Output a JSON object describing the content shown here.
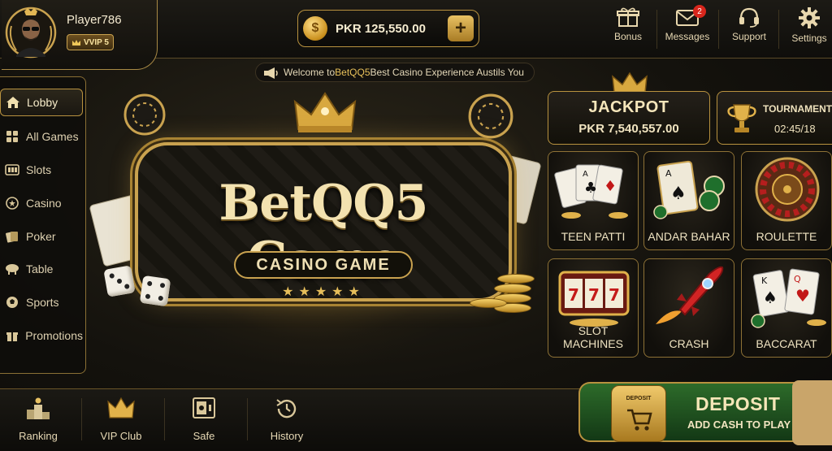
{
  "profile": {
    "name": "Player786",
    "vip": "VVIP 5"
  },
  "balance": {
    "amount": "PKR 125,550.00",
    "coin_symbol": "$",
    "add_label": "+"
  },
  "top_nav": [
    {
      "label": "Bonus",
      "icon": "gift-icon"
    },
    {
      "label": "Messages",
      "icon": "envelope-icon",
      "badge": "2"
    },
    {
      "label": "Support",
      "icon": "headset-icon"
    },
    {
      "label": "Settings",
      "icon": "gear-icon"
    }
  ],
  "ticker": {
    "prefix": "Welcome to ",
    "brand": "BetQQ5",
    "suffix": " Best Casino Experience Austils You"
  },
  "sidebar": {
    "items": [
      {
        "label": "Lobby",
        "icon": "home-icon"
      },
      {
        "label": "All Games",
        "icon": "grid-icon"
      },
      {
        "label": "Slots",
        "icon": "slot-icon"
      },
      {
        "label": "Casino",
        "icon": "chip-icon"
      },
      {
        "label": "Poker",
        "icon": "cards-icon"
      },
      {
        "label": "Table",
        "icon": "table-icon"
      },
      {
        "label": "Sports",
        "icon": "ball-icon"
      },
      {
        "label": "Promotions",
        "icon": "gift-icon"
      }
    ]
  },
  "banner": {
    "title": "BetQQ5 Game",
    "subtitle": "CASINO GAME",
    "stars": "★★★★★"
  },
  "jackpot": {
    "title": "JACKPOT",
    "amount": "PKR 7,540,557.00"
  },
  "tournament": {
    "title": "TOURNAMENT",
    "time": "02:45/18"
  },
  "games": [
    {
      "label": "TEEN PATTI"
    },
    {
      "label": "ANDAR BAHAR"
    },
    {
      "label": "ROULETTE"
    },
    {
      "label": "SLOT MACHINES"
    },
    {
      "label": "CRASH"
    },
    {
      "label": "BACCARAT"
    }
  ],
  "bottom_nav": [
    {
      "label": "Ranking",
      "icon": "podium-icon"
    },
    {
      "label": "VIP Club",
      "icon": "crown-icon"
    },
    {
      "label": "Safe",
      "icon": "safe-icon"
    },
    {
      "label": "History",
      "icon": "history-icon"
    }
  ],
  "deposit": {
    "title": "DEPOSIT",
    "subtitle": "ADD CASH TO PLAY",
    "cart_label": "DEPOSIT"
  },
  "colors": {
    "gold": "#b8923f",
    "deposit_green": "#2d6b2a",
    "badge_red": "#d8261c"
  }
}
